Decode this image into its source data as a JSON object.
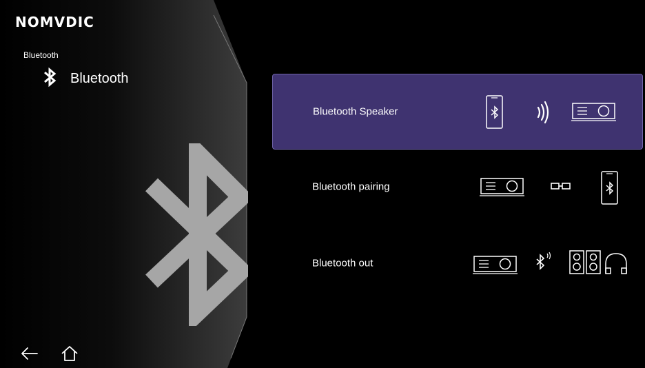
{
  "brand": {
    "logo": "NOMVDIC"
  },
  "header": {
    "breadcrumb": "Bluetooth",
    "title": "Bluetooth"
  },
  "menu": {
    "items": [
      {
        "label": "Bluetooth Speaker",
        "selected": true,
        "icons": [
          "phone-bluetooth-icon",
          "sound-waves-icon",
          "projector-icon"
        ]
      },
      {
        "label": "Bluetooth pairing",
        "selected": false,
        "icons": [
          "projector-icon",
          "link-icon",
          "phone-bluetooth-icon"
        ]
      },
      {
        "label": "Bluetooth out",
        "selected": false,
        "icons": [
          "projector-icon",
          "bluetooth-signal-icon",
          "speakers-icon",
          "headphones-icon"
        ]
      }
    ]
  },
  "nav": {
    "back_icon": "back-arrow-icon",
    "home_icon": "home-icon"
  },
  "colors": {
    "selected_bg": "#3f3370",
    "selected_border": "#6f64a8",
    "big_icon": "#a6a6a6"
  }
}
